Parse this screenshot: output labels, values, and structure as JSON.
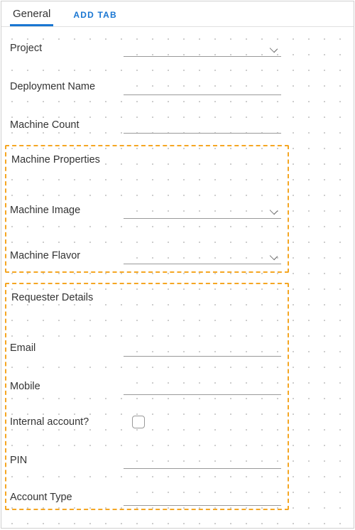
{
  "tabs": {
    "general": "General",
    "addTab": "ADD TAB"
  },
  "fields": {
    "project": "Project",
    "deploymentName": "Deployment Name",
    "machineCount": "Machine Count"
  },
  "group1": {
    "title": "Machine Properties",
    "machineImage": "Machine Image",
    "machineFlavor": "Machine Flavor"
  },
  "group2": {
    "title": "Requester Details",
    "email": "Email",
    "mobile": "Mobile",
    "internalAccount": "Internal account?",
    "pin": "PIN",
    "accountType": "Account Type"
  }
}
